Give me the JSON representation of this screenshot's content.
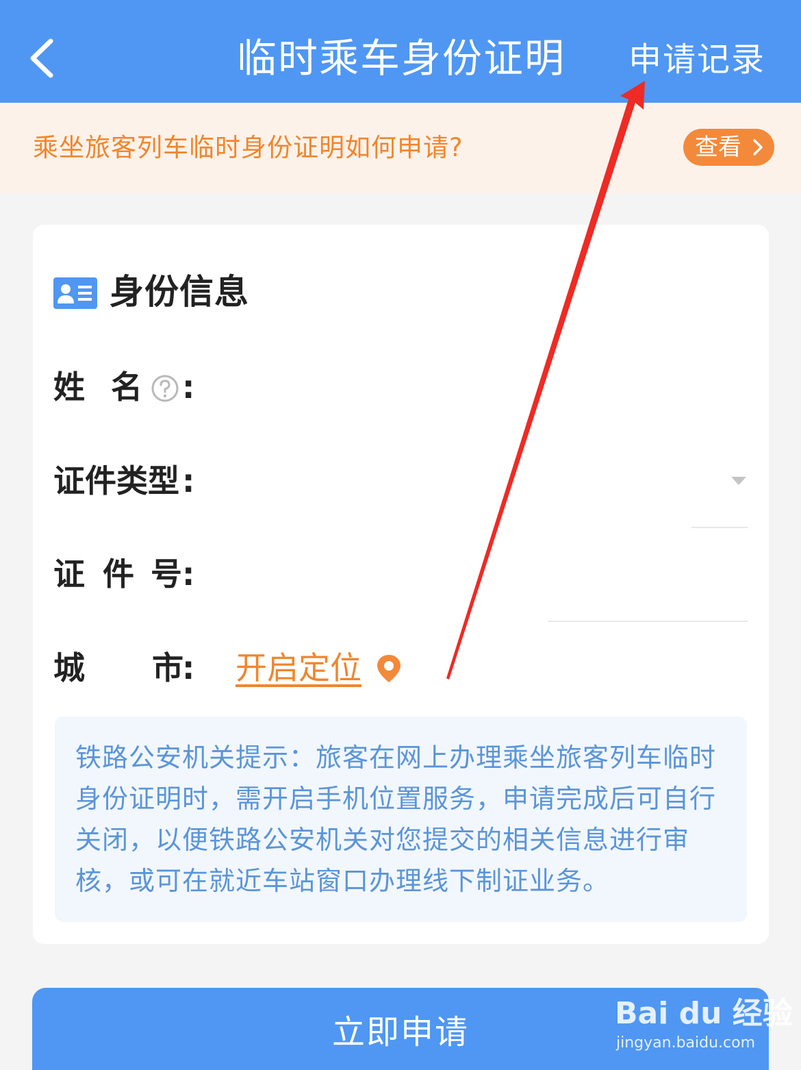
{
  "header": {
    "title": "临时乘车身份证明",
    "record_label": "申请记录"
  },
  "notice": {
    "text": "乘坐旅客列车临时身份证明如何申请?",
    "view_label": "查看"
  },
  "section": {
    "title": "身份信息"
  },
  "form": {
    "name_label_1": "姓",
    "name_label_2": "名",
    "id_type_label": "证件类型",
    "id_no_label_1": "证",
    "id_no_label_2": "件",
    "id_no_label_3": "号",
    "city_label_1": "城",
    "city_label_2": "市",
    "colon": ":",
    "locate_label": "开启定位"
  },
  "tip": {
    "text": "铁路公安机关提示：旅客在网上办理乘坐旅客列车临时身份证明时，需开启手机位置服务，申请完成后可自行关闭，以便铁路公安机关对您提交的相关信息进行审核，或可在就近车站窗口办理线下制证业务。"
  },
  "submit": {
    "label": "立即申请"
  },
  "watermark": {
    "logo": "Bai du 经验",
    "url": "jingyan.baidu.com"
  },
  "colors": {
    "primary": "#4f97f2",
    "accent": "#f0862d",
    "tip_text": "#5b95d8"
  }
}
